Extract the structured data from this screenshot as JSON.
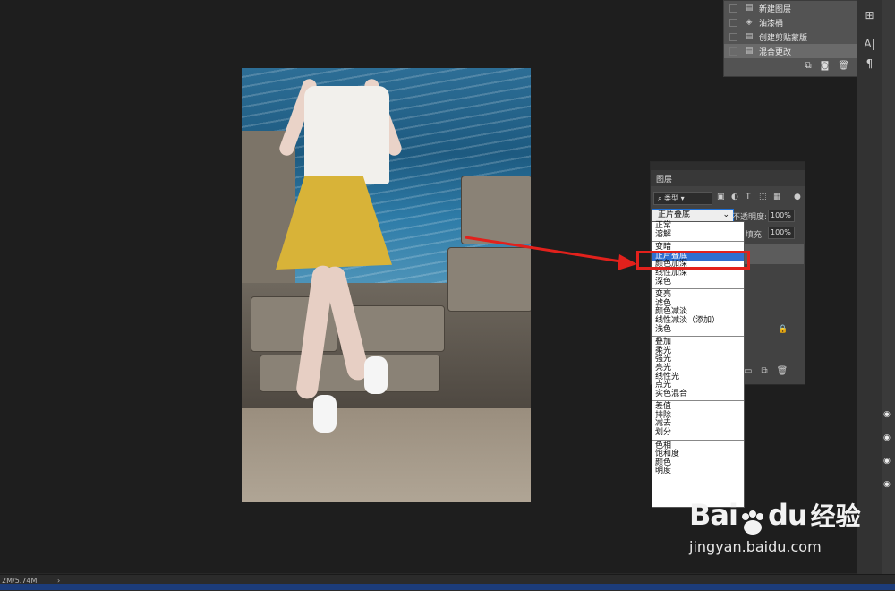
{
  "history_panel": {
    "items": [
      {
        "label": "新建图层",
        "icon": "document-icon"
      },
      {
        "label": "油漆桶",
        "icon": "paint-bucket-icon"
      },
      {
        "label": "创建剪贴蒙版",
        "icon": "document-icon"
      },
      {
        "label": "混合更改",
        "icon": "document-icon",
        "selected": true
      }
    ]
  },
  "layers_panel": {
    "tab": "图层",
    "filter_label": "类型",
    "blend_mode": "正片叠底",
    "opacity_label": "不透明度:",
    "opacity_value": "100%",
    "fill_label": "填充:",
    "fill_value": "100%"
  },
  "blend_dropdown": {
    "groups": [
      [
        "正常",
        "溶解"
      ],
      [
        "变暗",
        "正片叠底",
        "颜色加深",
        "线性加深",
        "深色"
      ],
      [
        "变亮",
        "滤色",
        "颜色减淡",
        "线性减淡（添加）",
        "浅色"
      ],
      [
        "叠加",
        "柔光",
        "强光",
        "亮光",
        "线性光",
        "点光",
        "实色混合"
      ],
      [
        "差值",
        "排除",
        "减去",
        "划分"
      ],
      [
        "色相",
        "饱和度",
        "颜色",
        "明度"
      ]
    ],
    "selected": "正片叠底"
  },
  "status_bar": {
    "doc_size": "2M/5.74M"
  },
  "watermark": {
    "brand": "Bai",
    "brand2": "du",
    "jingyan": "经验",
    "url": "jingyan.baidu.com"
  },
  "colors": {
    "highlight": "#2f6fd0",
    "annotation_red": "#e2211c",
    "panel_bg": "#424242"
  }
}
